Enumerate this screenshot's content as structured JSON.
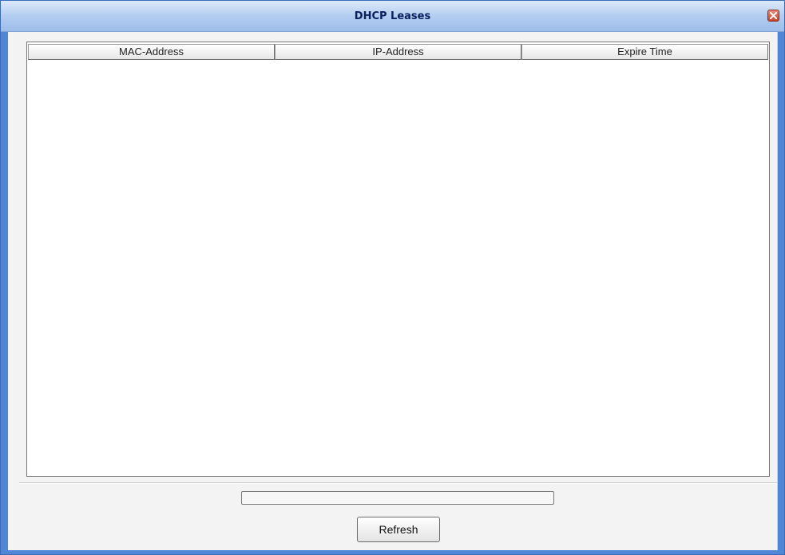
{
  "window": {
    "title": "DHCP Leases"
  },
  "table": {
    "columns": [
      "MAC-Address",
      "IP-Address",
      "Expire Time"
    ],
    "rows": []
  },
  "progress": {
    "value_percent": 0
  },
  "actions": {
    "refresh_label": "Refresh"
  },
  "icons": {
    "close": "close-icon"
  },
  "colors": {
    "window_border": "#4f86d6",
    "title_text": "#0a1f5c",
    "close_button": "#c5452f"
  }
}
